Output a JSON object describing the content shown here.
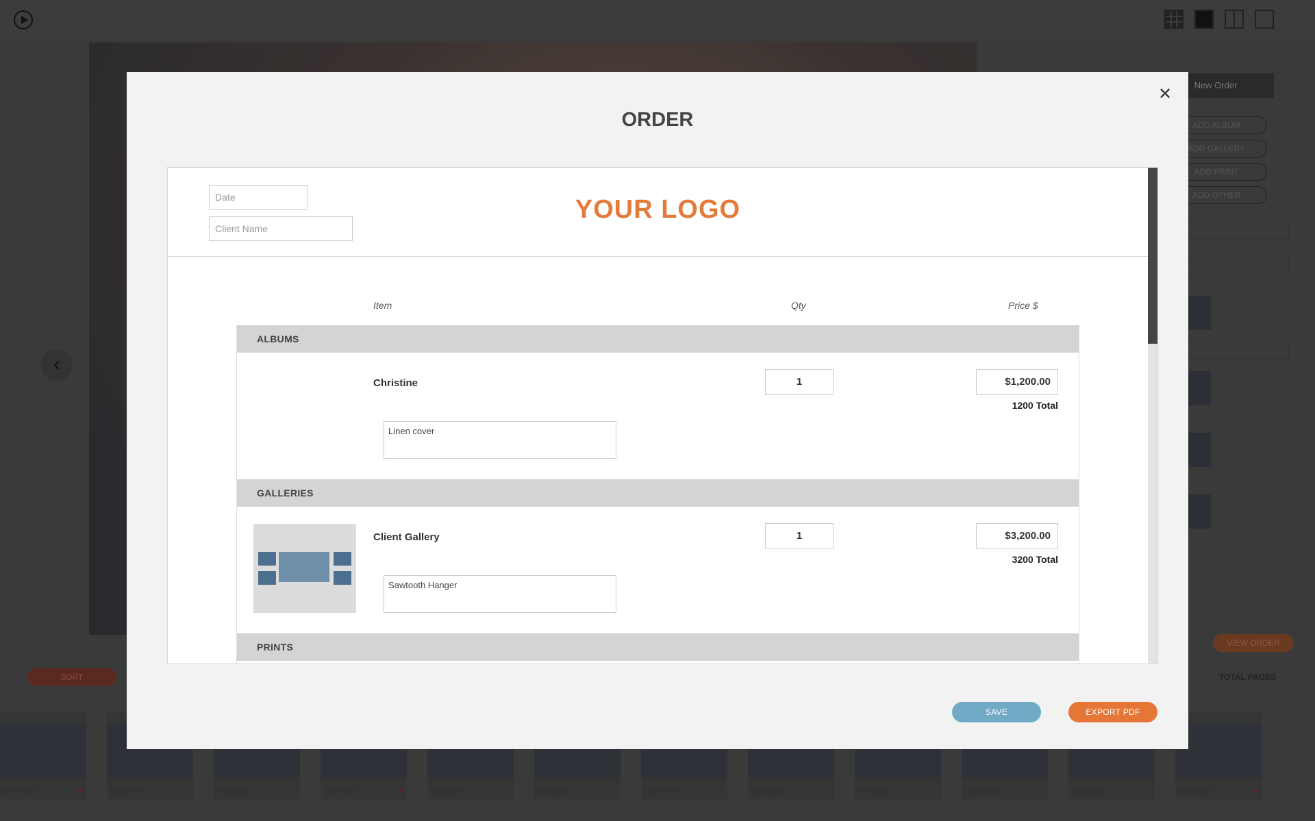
{
  "background": {
    "right_panel": {
      "new_order_label": "New Order",
      "add_buttons": [
        "ADD ALBUM",
        "ADD GALLERY",
        "ADD PRINT",
        "ADD OTHER"
      ],
      "view_order_label": "VIEW ORDER"
    },
    "bottom": {
      "sort_label": "SORT",
      "total_pages_label": "TOTAL PAGES"
    }
  },
  "modal": {
    "title": "ORDER",
    "logo_text": "YOUR LOGO",
    "date_placeholder": "Date",
    "client_name_placeholder": "Client Name",
    "columns": {
      "item": "Item",
      "qty": "Qty",
      "price": "Price $"
    },
    "sections": {
      "albums": {
        "title": "ALBUMS",
        "item": {
          "name": "Christine",
          "qty": "1",
          "price": "$1,200.00",
          "total": "1200 Total",
          "note": "Linen cover"
        }
      },
      "galleries": {
        "title": "GALLERIES",
        "item": {
          "name": "Client Gallery",
          "qty": "1",
          "price": "$3,200.00",
          "total": "3200 Total",
          "note": "Sawtooth Hanger"
        }
      },
      "prints": {
        "title": "PRINTS"
      }
    },
    "save_label": "SAVE",
    "export_label": "EXPORT PDF"
  },
  "colors": {
    "accent_orange": "#e57638",
    "save_blue": "#71aac6",
    "logo_orange": "#e37b3b"
  }
}
